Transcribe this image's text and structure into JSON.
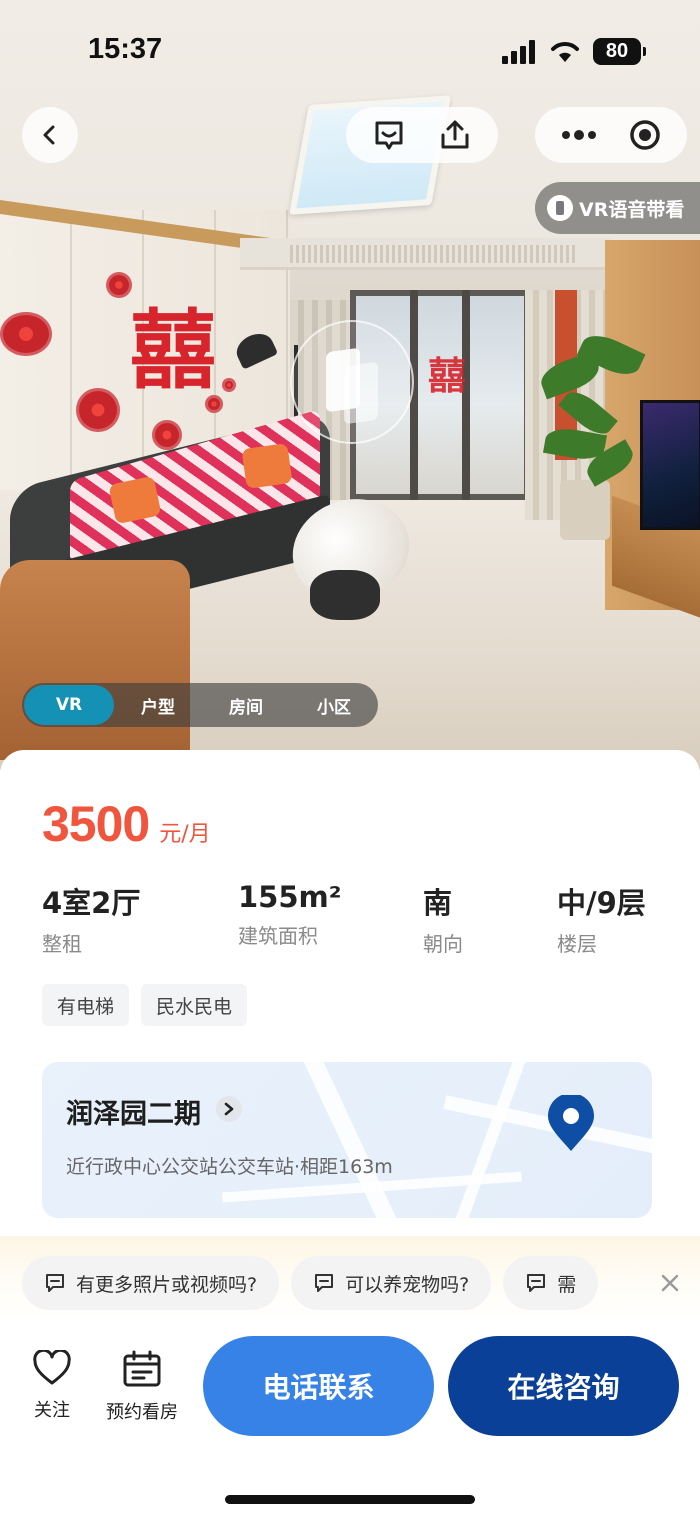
{
  "status_bar": {
    "time": "15:37",
    "battery": "80"
  },
  "hero": {
    "vr_voice_label": "VR语音带看",
    "tabs": [
      {
        "label": "VR",
        "active": true
      },
      {
        "label": "户型",
        "active": false
      },
      {
        "label": "房间",
        "active": false
      },
      {
        "label": "小区",
        "active": false
      }
    ]
  },
  "listing": {
    "price": "3500",
    "price_unit": "元/月",
    "specs": [
      {
        "value": "4室2厅",
        "label": "整租"
      },
      {
        "value": "155m²",
        "label": "建筑面积"
      },
      {
        "value": "南",
        "label": "朝向"
      },
      {
        "value": "中/9层",
        "label": "楼层"
      }
    ],
    "tags": [
      "有电梯",
      "民水民电"
    ]
  },
  "community": {
    "name": "润泽园二期",
    "distance": "近行政中心公交站公交车站·相距163m"
  },
  "suggestions": {
    "chips": [
      "有更多照片或视频吗?",
      "可以养宠物吗?",
      "需"
    ]
  },
  "bottom_bar": {
    "follow_label": "关注",
    "appointment_label": "预约看房",
    "call_label": "电话联系",
    "chat_label": "在线咨询"
  },
  "colors": {
    "price": "#f0563d",
    "call_button": "#3782e7",
    "chat_button": "#0a4097",
    "active_tab": "#1591b5"
  },
  "icons": [
    "back-arrow-icon",
    "feedback-icon",
    "share-icon",
    "more-icon",
    "target-icon",
    "vr-voice-icon",
    "chevron-right-icon",
    "map-pin-icon",
    "chat-bubble-icon",
    "close-icon",
    "heart-icon",
    "calendar-icon"
  ]
}
